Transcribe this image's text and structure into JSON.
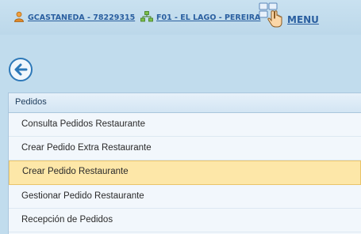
{
  "header": {
    "user_label": "GCASTANEDA - 78229315",
    "branch_label": "F01 - EL LAGO - PEREIRA",
    "menu_label": "MENU"
  },
  "icons": {
    "user": "user-icon",
    "branch": "network-icon",
    "menu": "hand-pointer-icon",
    "back": "back-arrow-icon"
  },
  "colors": {
    "background": "#c1dced",
    "link": "#2a5fa0",
    "selected_item": "#fde7a8"
  },
  "panel": {
    "title": "Pedidos",
    "items": [
      {
        "label": "Consulta Pedidos Restaurante"
      },
      {
        "label": "Crear Pedido Extra Restaurante"
      },
      {
        "label": "Crear Pedido Restaurante"
      },
      {
        "label": "Gestionar Pedido Restaurante"
      },
      {
        "label": "Recepción de Pedidos"
      }
    ],
    "selected_index": 2
  }
}
